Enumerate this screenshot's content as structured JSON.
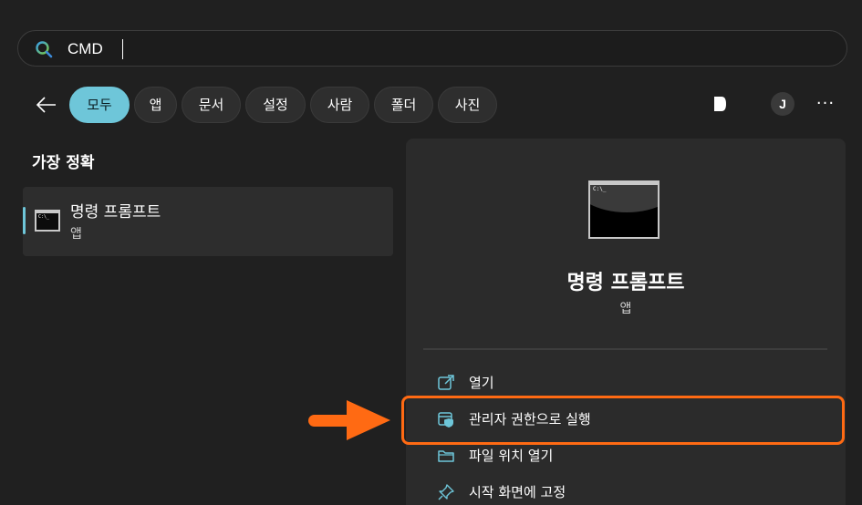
{
  "search": {
    "value": "CMD",
    "icon": "search-icon"
  },
  "filters": [
    {
      "label": "모두",
      "active": true
    },
    {
      "label": "앱"
    },
    {
      "label": "문서"
    },
    {
      "label": "설정"
    },
    {
      "label": "사람"
    },
    {
      "label": "폴더"
    },
    {
      "label": "사진"
    }
  ],
  "header": {
    "avatar_initial": "J",
    "more": "···"
  },
  "best_match": {
    "section_title": "가장 정확",
    "title": "명령 프롬프트",
    "subtitle": "앱",
    "prompt_text": "C:\\_"
  },
  "detail": {
    "title": "명령 프롬프트",
    "subtitle": "앱",
    "prompt_text": "C:\\_",
    "actions": [
      {
        "label": "열기",
        "icon": "open-external-icon"
      },
      {
        "label": "관리자 권한으로 실행",
        "icon": "admin-shield-icon",
        "highlighted": true
      },
      {
        "label": "파일 위치 열기",
        "icon": "folder-icon"
      },
      {
        "label": "시작 화면에 고정",
        "icon": "pin-icon"
      }
    ]
  },
  "colors": {
    "accent": "#6ec6d9",
    "highlight": "#ff6a13",
    "background": "#202020",
    "panel": "#2b2b2b"
  }
}
